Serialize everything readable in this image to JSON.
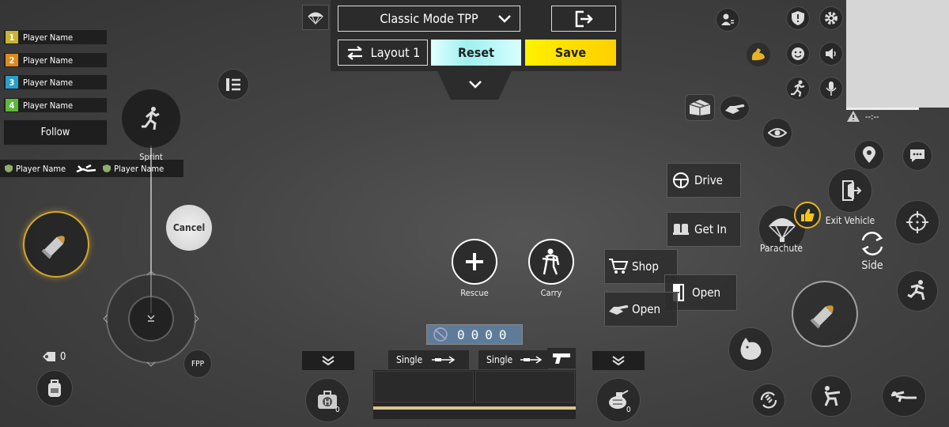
{
  "top": {
    "mode": "Classic Mode TPP",
    "layout": "Layout 1",
    "reset": "Reset",
    "save": "Save"
  },
  "teams": [
    {
      "num": "1",
      "name": "Player Name",
      "color": "#c8b432"
    },
    {
      "num": "2",
      "name": "Player Name",
      "color": "#e08a1e"
    },
    {
      "num": "3",
      "name": "Player Name",
      "color": "#2aa0c8"
    },
    {
      "num": "4",
      "name": "Player Name",
      "color": "#5cb83a"
    }
  ],
  "follow": "Follow",
  "sprint": "Sprint",
  "kill_feed": {
    "left": "Player Name",
    "right": "Player Name"
  },
  "cancel": "Cancel",
  "fpp": "FPP",
  "throwable_count": "0",
  "actions": {
    "rescue": "Rescue",
    "carry": "Carry",
    "drive": "Drive",
    "get_in": "Get In",
    "shop": "Shop",
    "open1": "Open",
    "open2": "Open",
    "parachute": "Parachute",
    "exit_vehicle": "Exit Vehicle",
    "side": "Side"
  },
  "ammo_counter": "0000",
  "weapon_slots": [
    {
      "mode": "Single"
    },
    {
      "mode": "Single"
    }
  ],
  "heal_count": "0",
  "grenade_count": "0",
  "minimap_text": "--:--",
  "colors": {
    "save": "#ffe600",
    "reset": "#aef5f5",
    "panel": "#2c2c2c",
    "accent": "#f5c518"
  }
}
